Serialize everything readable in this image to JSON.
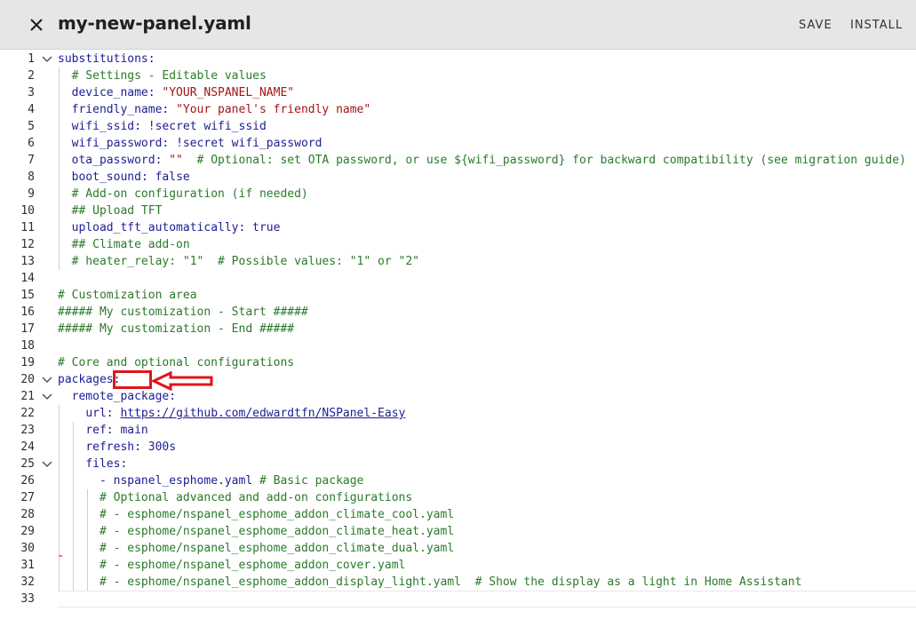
{
  "header": {
    "title": "my-new-panel.yaml",
    "save_label": "SAVE",
    "install_label": "INSTALL",
    "close_icon": "close-icon"
  },
  "editor": {
    "lines": [
      {
        "n": "1",
        "fold": true,
        "html": "<span class=\"k\">substitutions</span>:"
      },
      {
        "n": "2",
        "html": "  <span class=\"c\"># Settings - Editable values</span>"
      },
      {
        "n": "3",
        "html": "  <span class=\"k\">device_name</span>: <span class=\"s\">\"YOUR_NSPANEL_NAME\"</span>"
      },
      {
        "n": "4",
        "html": "  <span class=\"k\">friendly_name</span>: <span class=\"s\">\"Your panel's friendly name\"</span>"
      },
      {
        "n": "5",
        "html": "  <span class=\"k\">wifi_ssid</span>: <span class=\"sec\">!secret wifi_ssid</span>"
      },
      {
        "n": "6",
        "html": "  <span class=\"k\">wifi_password</span>: <span class=\"sec\">!secret wifi_password</span>"
      },
      {
        "n": "7",
        "html": "  <span class=\"k\">ota_password</span>: <span class=\"s\">\"\"</span>  <span class=\"c\"># Optional: set OTA password, or use ${wifi_password} for backward compatibility (see migration guide)</span>"
      },
      {
        "n": "8",
        "html": "  <span class=\"k\">boot_sound</span>: <span class=\"b\">false</span>"
      },
      {
        "n": "9",
        "html": "  <span class=\"c\"># Add-on configuration (if needed)</span>"
      },
      {
        "n": "10",
        "html": "  <span class=\"c\">## Upload TFT</span>"
      },
      {
        "n": "11",
        "html": "  <span class=\"k\">upload_tft_automatically</span>: <span class=\"b\">true</span>"
      },
      {
        "n": "12",
        "html": "  <span class=\"c\">## Climate add-on</span>"
      },
      {
        "n": "13",
        "html": "  <span class=\"c\"># heater_relay: \"1\"  # Possible values: \"1\" or \"2\"</span>"
      },
      {
        "n": "14",
        "html": ""
      },
      {
        "n": "15",
        "html": "<span class=\"c\"># Customization area</span>"
      },
      {
        "n": "16",
        "html": "<span class=\"c\">##### My customization - Start #####</span>"
      },
      {
        "n": "17",
        "html": "<span class=\"c\">##### My customization - End #####</span>"
      },
      {
        "n": "18",
        "html": ""
      },
      {
        "n": "19",
        "html": "<span class=\"c\"># Core and optional configurations</span>"
      },
      {
        "n": "20",
        "fold": true,
        "html": "<span class=\"k\">packages</span>:"
      },
      {
        "n": "21",
        "fold": true,
        "html": "  <span class=\"k\">remote_package</span>:"
      },
      {
        "n": "22",
        "html": "    <span class=\"k\">url</span>: <span class=\"u\">https://github.com/edwardtfn/NSPanel-Easy</span>"
      },
      {
        "n": "23",
        "html": "    <span class=\"k\">ref</span>: <span class=\"p\">main</span>"
      },
      {
        "n": "24",
        "html": "    <span class=\"k\">refresh</span>: <span class=\"p\">300s</span>"
      },
      {
        "n": "25",
        "fold": true,
        "html": "    <span class=\"k\">files</span>:"
      },
      {
        "n": "26",
        "html": "      <span class=\"p\">- nspanel_esphome.yaml</span> <span class=\"c\"># Basic package</span>"
      },
      {
        "n": "27",
        "html": "      <span class=\"c\"># Optional advanced and add-on configurations</span>"
      },
      {
        "n": "28",
        "html": "      <span class=\"c\"># - esphome/nspanel_esphome_addon_climate_cool.yaml</span>"
      },
      {
        "n": "29",
        "html": "      <span class=\"c\"># - esphome/nspanel_esphome_addon_climate_heat.yaml</span>"
      },
      {
        "n": "30",
        "html": "      <span class=\"c\"># - esphome/nspanel_esphome_addon_climate_dual.yaml</span>"
      },
      {
        "n": "31",
        "html": "      <span class=\"c\"># - esphome/nspanel_esphome_addon_cover.yaml</span>"
      },
      {
        "n": "32",
        "html": "      <span class=\"c\"># - esphome/nspanel_esphome_addon_display_light.yaml  # Show the display as a light in Home Assistant</span>"
      },
      {
        "n": "33",
        "html": ""
      }
    ]
  },
  "colors": {
    "header_bg": "#e6e6e6",
    "key": "#1d1d95",
    "string": "#a31515",
    "comment": "#2b7a2b",
    "annotation": "#e0141b"
  }
}
